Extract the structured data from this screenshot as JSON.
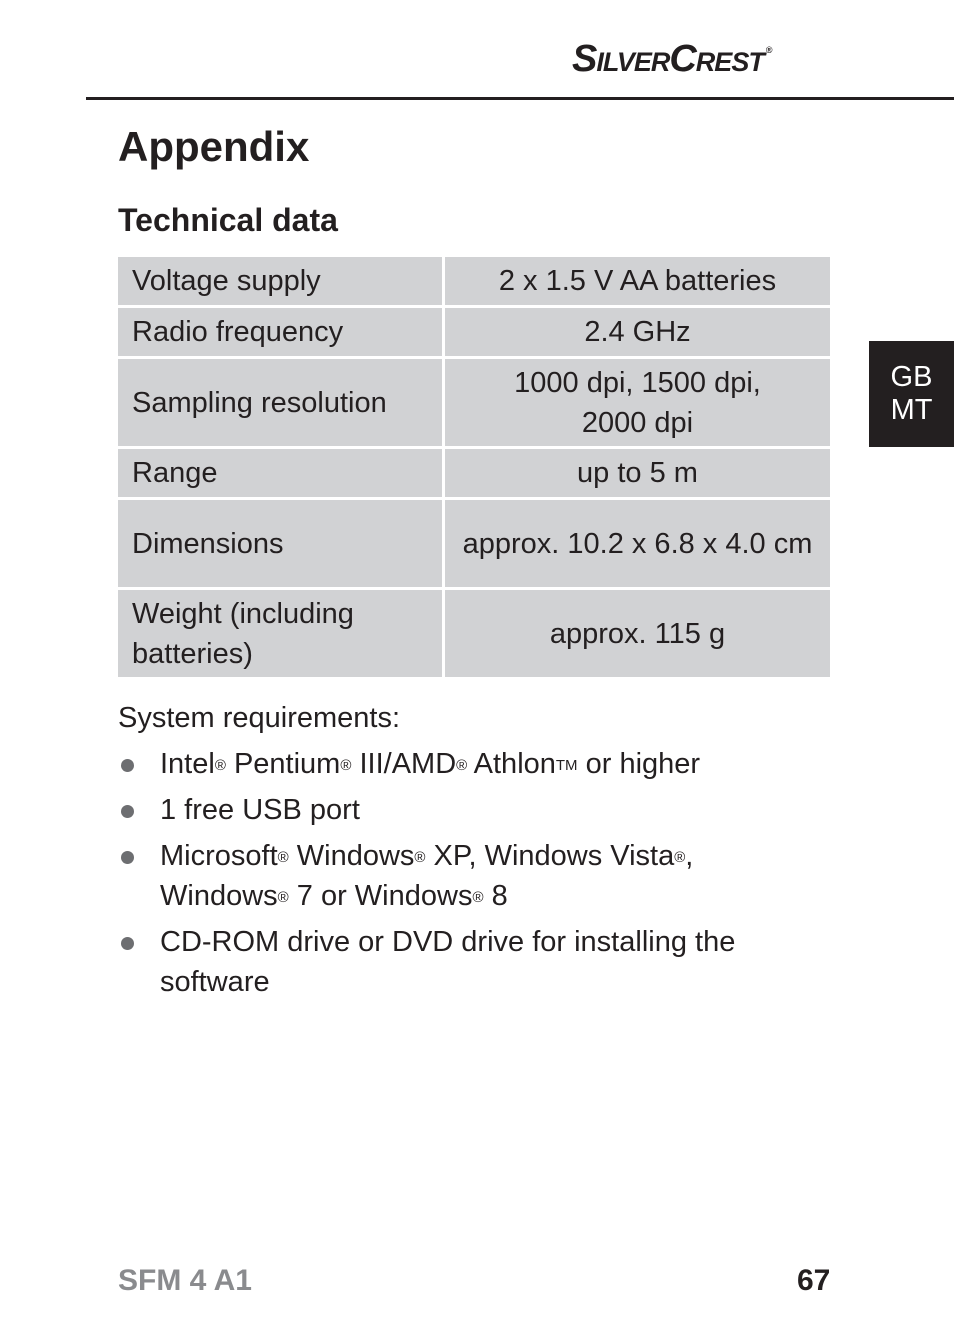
{
  "header": {
    "brand": "SilverCrest",
    "brand_mark": "®"
  },
  "language_tab": {
    "line1": "GB",
    "line2": "MT"
  },
  "title": "Appendix",
  "section_title": "Technical data",
  "spec_table": [
    {
      "label": "Voltage supply",
      "value": "2 x 1.5 V AA batteries"
    },
    {
      "label": "Radio frequency",
      "value": "2.4 GHz"
    },
    {
      "label": "Sampling resolution",
      "value_lines": [
        "1000 dpi, 1500 dpi,",
        "2000 dpi"
      ]
    },
    {
      "label": "Range",
      "value": "up to 5 m"
    },
    {
      "label": "Dimensions",
      "value": "approx. 10.2 x 6.8 x 4.0 cm"
    },
    {
      "label_lines": [
        "Weight (including",
        "batteries)"
      ],
      "value": "approx. 115 g"
    }
  ],
  "system_requirements": {
    "title": "System requirements:",
    "items": [
      {
        "parts": [
          "Intel",
          "®",
          " Pentium",
          "®",
          " III/AMD",
          "®",
          " Athlon",
          "TM",
          " or higher"
        ]
      },
      {
        "parts": [
          "1 free USB port"
        ]
      },
      {
        "parts": [
          "Microsoft",
          "®",
          " Windows",
          "®",
          " XP, Windows Vista",
          "®",
          ",",
          "Windows",
          "®",
          " 7 or Windows",
          "®",
          " 8"
        ]
      },
      {
        "parts": [
          "CD-ROM drive or DVD drive for installing the",
          "software"
        ]
      }
    ]
  },
  "footer": {
    "model": "SFM 4 A1",
    "page_number": "67"
  }
}
